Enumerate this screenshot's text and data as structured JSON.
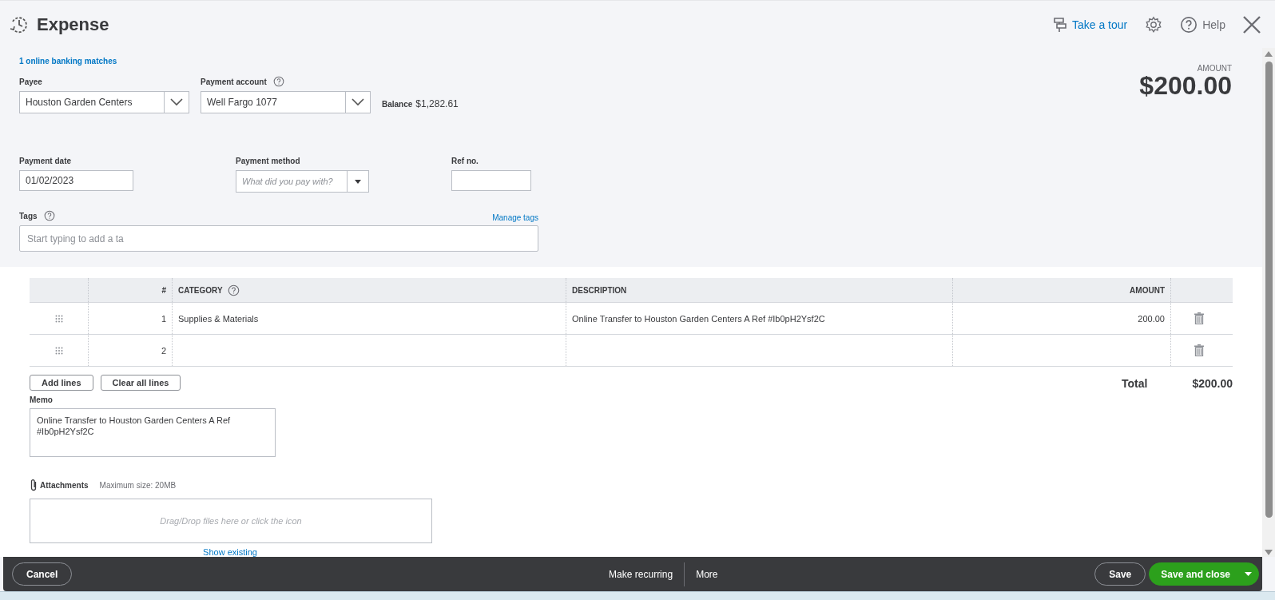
{
  "window": {
    "title": "Expense"
  },
  "header_actions": {
    "tour": "Take a tour",
    "help": "Help"
  },
  "banking_matches": "1 online banking matches",
  "payee": {
    "label": "Payee",
    "value": "Houston Garden Centers"
  },
  "payment_account": {
    "label": "Payment account",
    "value": "Well Fargo 1077"
  },
  "balance": {
    "label": "Balance",
    "value": "$1,282.61"
  },
  "amount": {
    "label": "AMOUNT",
    "value": "$200.00"
  },
  "payment_date": {
    "label": "Payment date",
    "value": "01/02/2023"
  },
  "payment_method": {
    "label": "Payment method",
    "placeholder": "What did you pay with?"
  },
  "ref_no": {
    "label": "Ref no."
  },
  "tags": {
    "label": "Tags",
    "link": "Manage tags",
    "placeholder": "Start typing to add a ta"
  },
  "table": {
    "columns": [
      "#",
      "CATEGORY",
      "DESCRIPTION",
      "AMOUNT"
    ],
    "rows": [
      {
        "number": "1",
        "category": "Supplies & Materials",
        "description": "Online Transfer to Houston Garden Centers A Ref #Ib0pH2Ysf2C",
        "amount": "200.00"
      },
      {
        "number": "2"
      }
    ]
  },
  "line_buttons": [
    "Add lines",
    "Clear all lines"
  ],
  "total": {
    "label": "Total",
    "value": "$200.00"
  },
  "memo": {
    "label": "Memo",
    "value": "Online Transfer to Houston Garden Centers A Ref #Ib0pH2Ysf2C"
  },
  "attachments": {
    "label": "Attachments",
    "note": "Maximum size: 20MB",
    "dropzone": "Drag/Drop files here or click the icon",
    "link": "Show existing"
  },
  "footer": {
    "cancel": "Cancel",
    "recurring": "Make recurring",
    "more": "More",
    "save": "Save",
    "save_close": "Save and close"
  }
}
